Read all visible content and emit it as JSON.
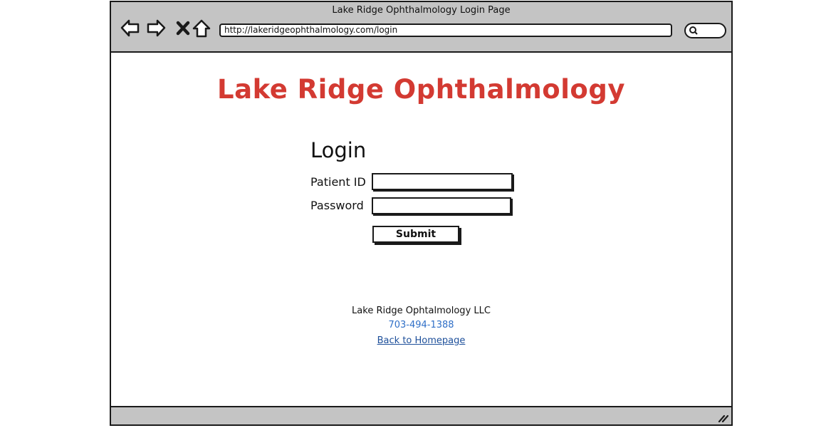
{
  "window": {
    "title": "Lake Ridge Ophthalmology Login Page",
    "url": "http://lakeridgeophthalmology.com/login"
  },
  "toolbar": {
    "back_icon": "arrow-left-icon",
    "forward_icon": "arrow-right-icon",
    "stop_icon": "close-icon",
    "home_icon": "home-icon",
    "search_icon": "search-icon"
  },
  "page": {
    "site_title": "Lake Ridge Ophthalmology",
    "login_heading": "Login",
    "fields": {
      "patient_id_label": "Patient ID",
      "patient_id_value": "",
      "password_label": "Password",
      "password_value": ""
    },
    "submit_label": "Submit"
  },
  "footer": {
    "company": "Lake Ridge Ophtalmology LLC",
    "phone": "703-494-1388",
    "homepage_link": "Back to Homepage"
  },
  "colors": {
    "brand_red": "#d33a32",
    "link_blue": "#2f6fc7",
    "chrome_gray": "#c4c4c4"
  }
}
